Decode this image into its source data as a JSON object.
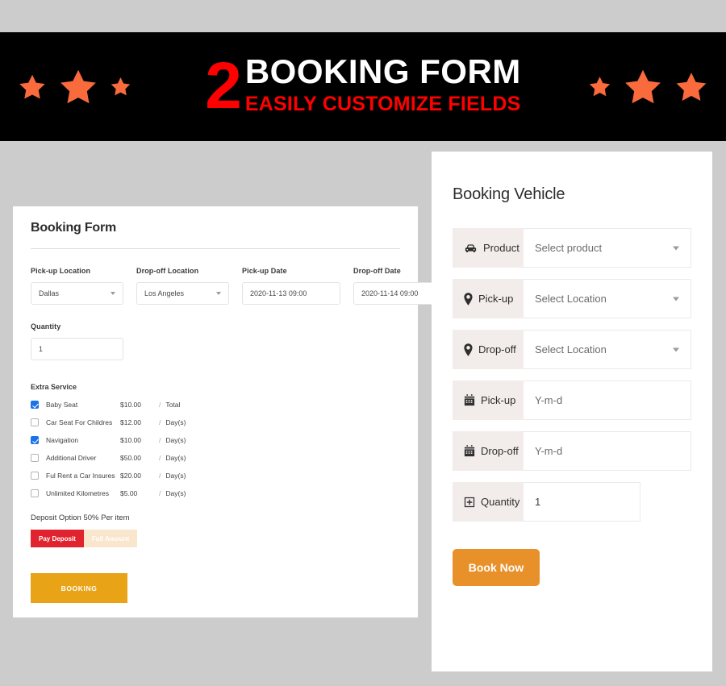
{
  "banner": {
    "number": "2",
    "title": "BOOKING FORM",
    "subtitle": "EASILY CUSTOMIZE FIELDS",
    "star_color": "#F96A3C",
    "number_color": "#FF0000",
    "title_color": "#FFFFFF",
    "subtitle_color": "#FF0000",
    "background_color": "#000000",
    "stars_left": [
      "star-icon-medium",
      "star-icon-large",
      "star-icon-small"
    ],
    "stars_right": [
      "star-icon-small",
      "star-icon-large",
      "star-icon-medium"
    ]
  },
  "page": {
    "background_color": "#CCCCCC"
  },
  "booking_form": {
    "title": "Booking Form",
    "fields": [
      {
        "label": "Pick-up Location",
        "value": "Dallas",
        "type": "select"
      },
      {
        "label": "Drop-off Location",
        "value": "Los Angeles",
        "type": "select"
      },
      {
        "label": "Pick-up Date",
        "value": "2020-11-13 09:00",
        "type": "date"
      },
      {
        "label": "Drop-off Date",
        "value": "2020-11-14 09:00",
        "type": "date"
      }
    ],
    "quantity": {
      "label": "Quantity",
      "value": "1"
    },
    "extra_service": {
      "title": "Extra Service",
      "separator": "/",
      "items": [
        {
          "name": "Baby Seat",
          "price": "$10.00",
          "unit": "Total",
          "checked": true
        },
        {
          "name": "Car Seat For Childres",
          "price": "$12.00",
          "unit": "Day(s)",
          "checked": false
        },
        {
          "name": "Navigation",
          "price": "$10.00",
          "unit": "Day(s)",
          "checked": true
        },
        {
          "name": "Additional Driver",
          "price": "$50.00",
          "unit": "Day(s)",
          "checked": false
        },
        {
          "name": "Ful Rent a Car Insures",
          "price": "$20.00",
          "unit": "Day(s)",
          "checked": false
        },
        {
          "name": "Unlimited Kilometres",
          "price": "$5.00",
          "unit": "Day(s)",
          "checked": false
        }
      ]
    },
    "deposit": {
      "label": "Deposit Option 50% Per item",
      "pay_deposit_label": "Pay Deposit",
      "full_amount_label": "Full Amount",
      "active": "Pay Deposit",
      "active_color": "#E0232E",
      "inactive_color": "#FAE5CD"
    },
    "submit_label": "BOOKING",
    "submit_color": "#E8A317"
  },
  "booking_vehicle": {
    "title": "Booking Vehicle",
    "label_background": "#F2ECEB",
    "rows": [
      {
        "icon": "car-icon",
        "label": "Product",
        "value": "Select product",
        "control": "select",
        "value_is_placeholder": true
      },
      {
        "icon": "map-pin-icon",
        "label": "Pick-up",
        "value": "Select Location",
        "control": "select",
        "value_is_placeholder": true
      },
      {
        "icon": "map-pin-icon",
        "label": "Drop-off",
        "value": "Select Location",
        "control": "select",
        "value_is_placeholder": true
      },
      {
        "icon": "calendar-icon",
        "label": "Pick-up",
        "value": "Y-m-d",
        "control": "date",
        "value_is_placeholder": true
      },
      {
        "icon": "calendar-icon",
        "label": "Drop-off",
        "value": "Y-m-d",
        "control": "date",
        "value_is_placeholder": true
      },
      {
        "icon": "plus-box-icon",
        "label": "Quantity",
        "value": "1",
        "control": "number",
        "value_is_placeholder": false
      }
    ],
    "submit_label": "Book Now",
    "submit_color": "#E8912A"
  }
}
